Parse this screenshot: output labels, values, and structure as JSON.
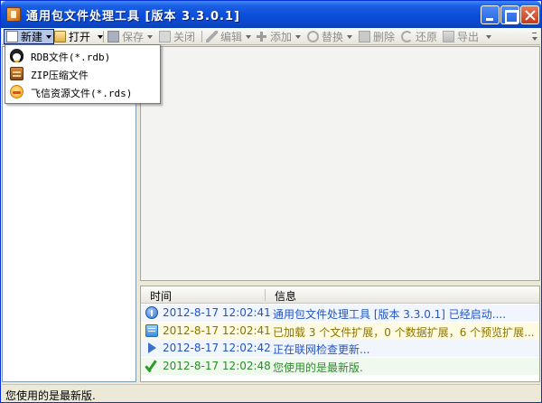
{
  "window": {
    "title": "通用包文件处理工具 [版本 3.3.0.1]"
  },
  "toolbar": {
    "new_label": "新建",
    "open_label": "打开",
    "save_label": "保存",
    "close_label": "关闭",
    "edit_label": "编辑",
    "add_label": "添加",
    "replace_label": "替换",
    "delete_label": "删除",
    "restore_label": "还原",
    "export_label": "导出"
  },
  "new_menu": {
    "items": [
      {
        "label": "RDB文件(*.rdb)",
        "icon": "penguin-icon"
      },
      {
        "label": "ZIP压缩文件",
        "icon": "zip-archive-icon"
      },
      {
        "label": "飞信资源文件(*.rds)",
        "icon": "fetion-icon"
      }
    ]
  },
  "log": {
    "columns": {
      "time": "时间",
      "message": "信息"
    },
    "rows": [
      {
        "icon": "info-icon",
        "time": "2012-8-17 12:02:41",
        "message": "通用包文件处理工具 [版本 3.3.0.1] 已经启动....",
        "color": "#2255c4",
        "bg": "#f1f5fd"
      },
      {
        "icon": "message-icon",
        "time": "2012-8-17 12:02:41",
        "message": "已加载 3 个文件扩展，0 个数据扩展，6 个预览扩展...",
        "color": "#8a7400",
        "bg": "#fffbe2"
      },
      {
        "icon": "play-icon",
        "time": "2012-8-17 12:02:42",
        "message": "正在联网检查更新...",
        "color": "#2255c4",
        "bg": "#f1f5fd"
      },
      {
        "icon": "checkmark-icon",
        "time": "2012-8-17 12:02:48",
        "message": "您使用的是最新版.",
        "color": "#2c8a2c",
        "bg": "#f0f9ee"
      }
    ]
  },
  "status": {
    "text": "您使用的是最新版."
  }
}
